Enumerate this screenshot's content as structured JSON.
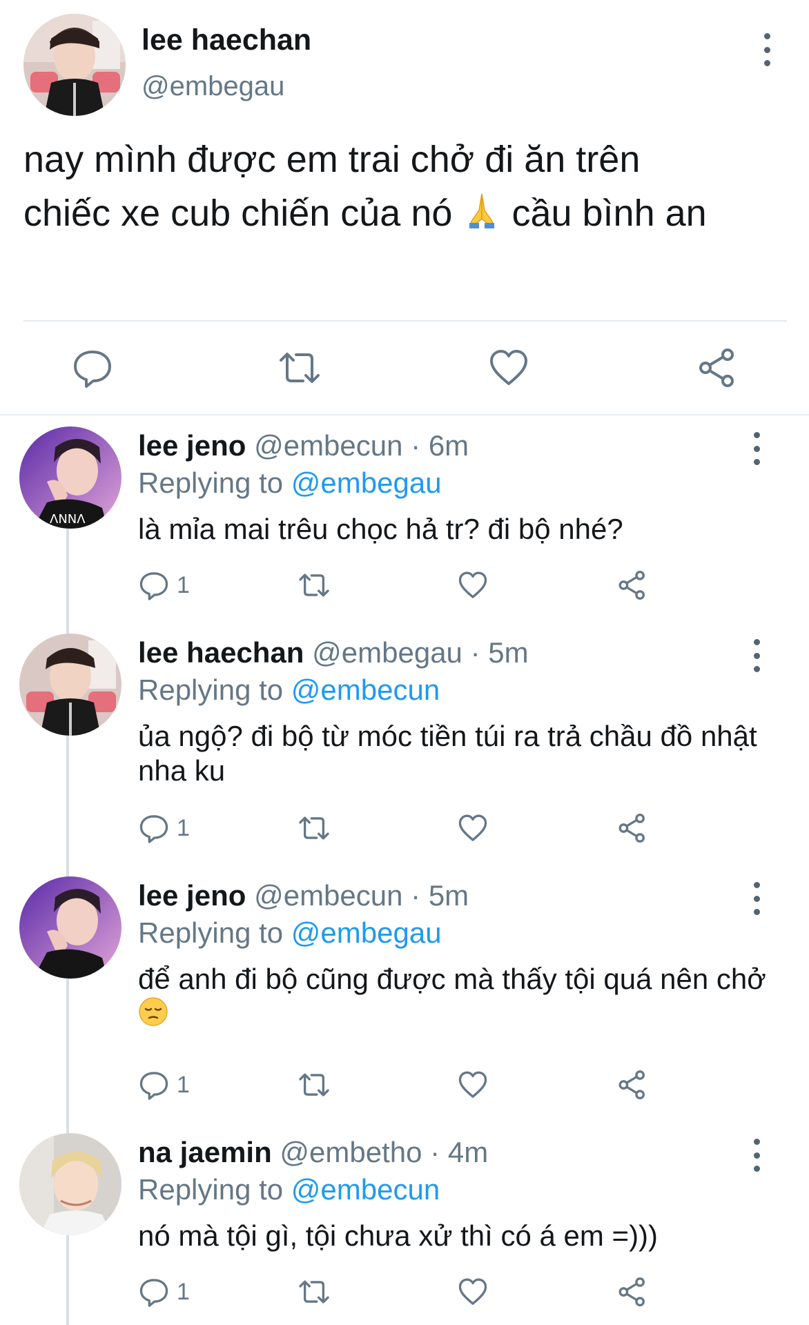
{
  "main_tweet": {
    "name": "lee haechan",
    "handle": "@embegau",
    "text_line1": "nay mình được em trai chở đi ăn trên",
    "text_line2": "chiếc xe cub chiến của nó",
    "text_line2_end": "cầu bình an",
    "emoji": "folded-hands",
    "actions": [
      "reply-icon",
      "retweet-icon",
      "like-icon",
      "share-icon"
    ]
  },
  "replies": [
    {
      "name": "lee jeno",
      "meta": "@embecun · 6m",
      "replying_label": "Replying to",
      "replying_to": "@embegau",
      "text": "là mỉa mai trêu chọc hả tr? đi bộ nhé?",
      "reply_count": "1"
    },
    {
      "name": "lee haechan",
      "meta": "@embegau · 5m",
      "replying_label": "Replying to",
      "replying_to": "@embecun",
      "text": "ủa ngộ? đi bộ từ móc tiền túi ra trả chầu đồ nhật nha ku",
      "reply_count": "1"
    },
    {
      "name": "lee jeno",
      "meta": "@embecun · 5m",
      "replying_label": "Replying to",
      "replying_to": "@embegau",
      "text": "để anh đi bộ cũng được mà thấy tội quá nên chở",
      "emoji": "pensive-face",
      "reply_count": "1"
    },
    {
      "name": "na jaemin",
      "meta": "@embetho · 4m",
      "replying_label": "Replying to",
      "replying_to": "@embecun",
      "text": "nó mà tội gì, tội chưa xử thì có á em =)))",
      "reply_count": "1"
    }
  ],
  "colors": {
    "mention": "#1d9bf0",
    "muted": "#657786",
    "text": "#14171a",
    "divider": "#e1e8ed"
  }
}
